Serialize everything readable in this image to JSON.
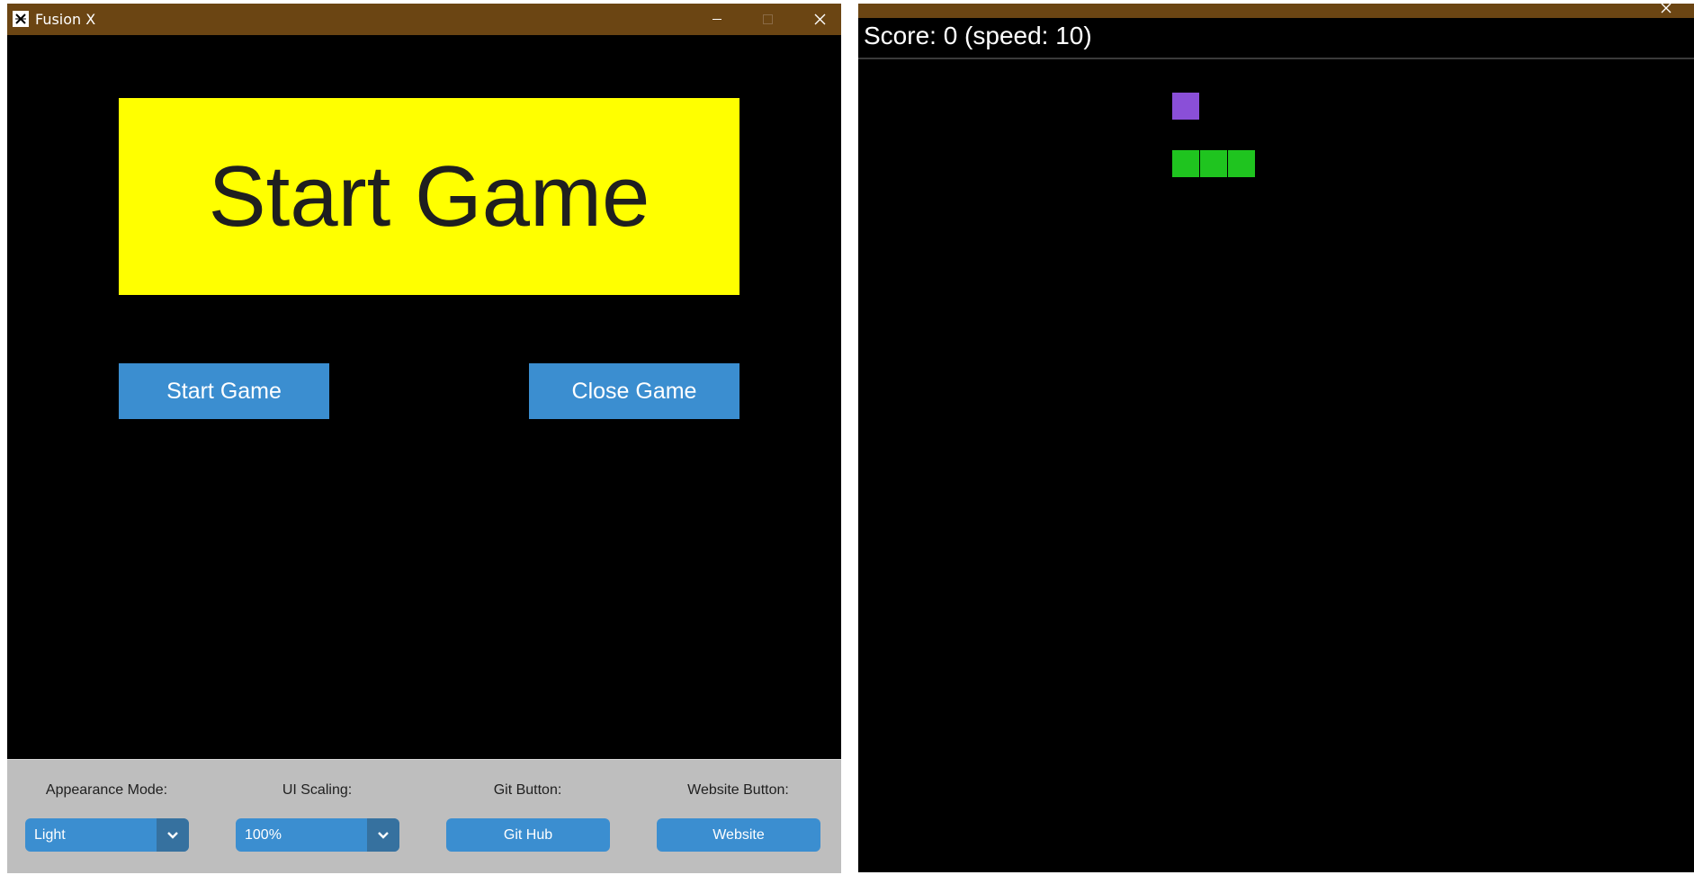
{
  "launcher": {
    "window_title": "Fusion X",
    "banner_text": "Start Game",
    "start_button_label": "Start Game",
    "close_button_label": "Close Game",
    "settings": {
      "appearance_label": "Appearance Mode:",
      "appearance_value": "Light",
      "scaling_label": "UI Scaling:",
      "scaling_value": "100%",
      "git_label": "Git Button:",
      "git_button_label": "Git Hub",
      "website_label": "Website Button:",
      "website_button_label": "Website"
    },
    "colors": {
      "titlebar": "#6b4513",
      "banner": "#ffff00",
      "button": "#3b8ed0",
      "button_dark": "#36719f",
      "panel": "#bebebe"
    }
  },
  "game": {
    "score_text": "Score: 0 (speed: 10)",
    "score": 0,
    "speed": 10,
    "food_color": "#8a4fd8",
    "snake_color": "#1fc41f",
    "snake_length": 3
  }
}
